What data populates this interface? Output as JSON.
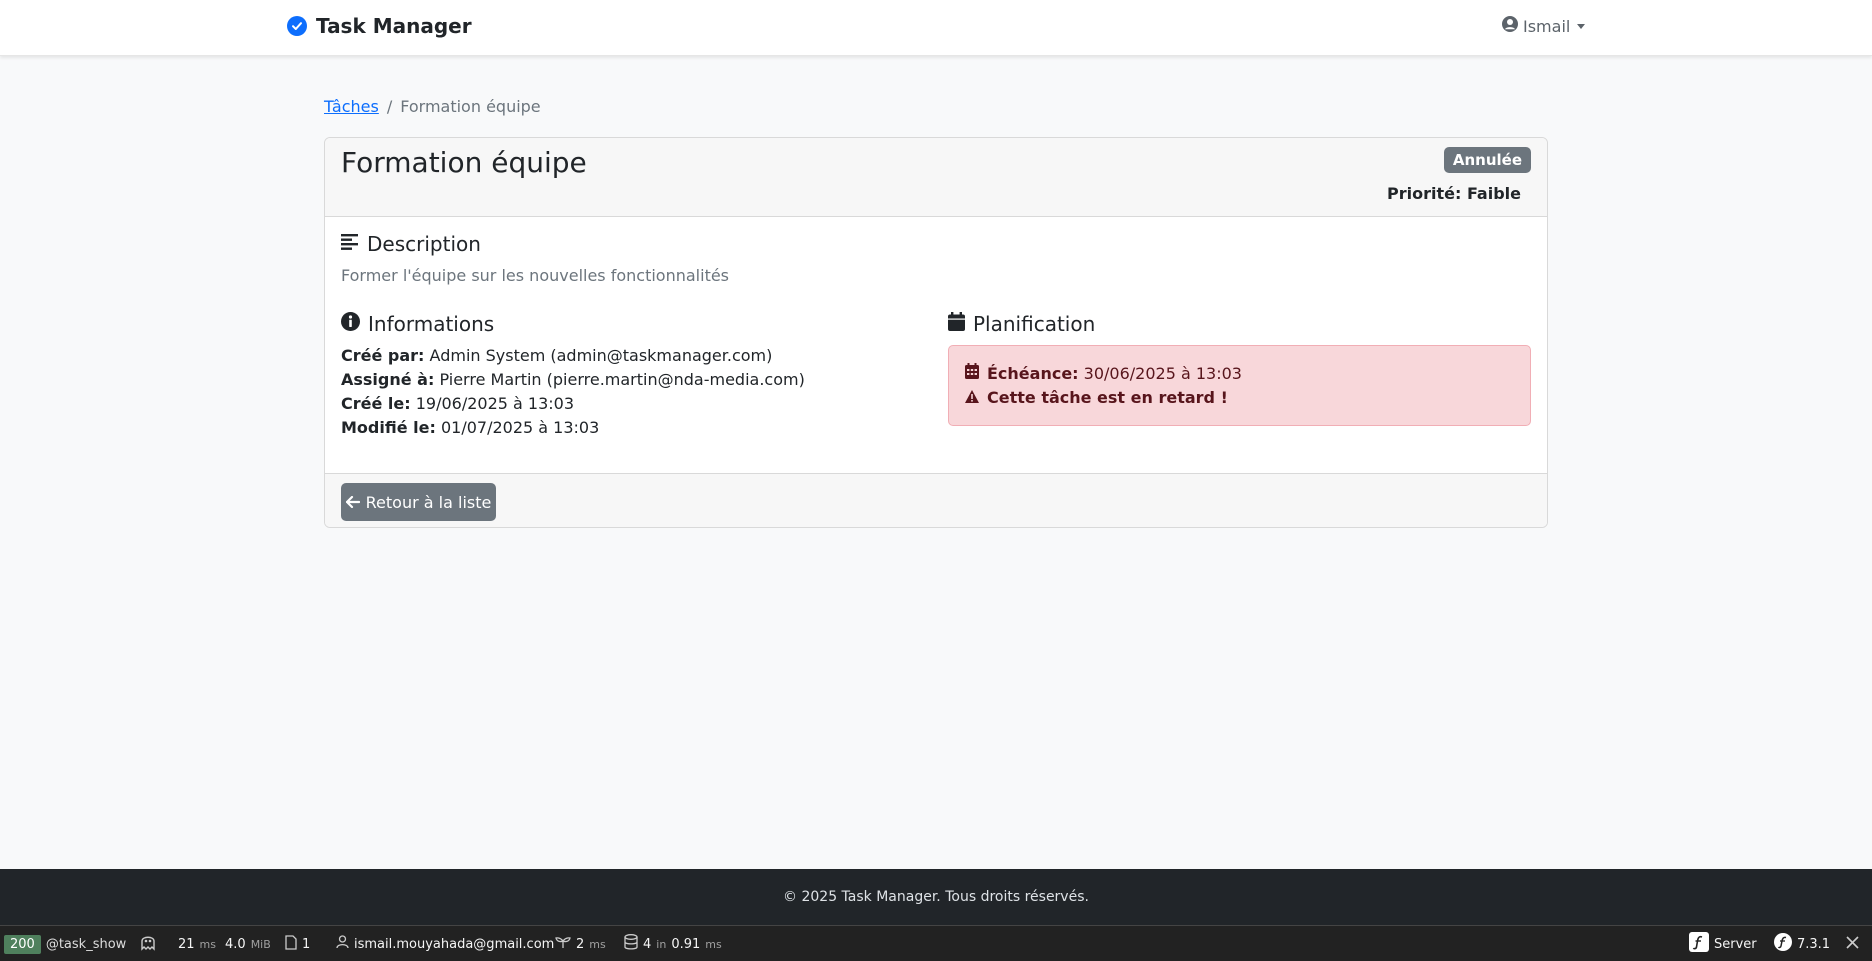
{
  "navbar": {
    "brand": "Task Manager",
    "user_name": "Ismail"
  },
  "breadcrumb": {
    "parent": "Tâches",
    "separator": "/",
    "current": "Formation équipe"
  },
  "task": {
    "title": "Formation équipe",
    "status": "Annulée",
    "priority": "Priorité: Faible"
  },
  "description": {
    "heading": "Description",
    "text": "Former l'équipe sur les nouvelles fonctionnalités"
  },
  "informations": {
    "heading": "Informations",
    "items": [
      {
        "label": "Créé par:",
        "value": "Admin System (admin@taskmanager.com)"
      },
      {
        "label": "Assigné à:",
        "value": "Pierre Martin (pierre.martin@nda-media.com)"
      },
      {
        "label": "Créé le:",
        "value": "19/06/2025 à 13:03"
      },
      {
        "label": "Modifié le:",
        "value": "01/07/2025 à 13:03"
      }
    ]
  },
  "planification": {
    "heading": "Planification",
    "due_label": "Échéance:",
    "due_value": "30/06/2025 à 13:03",
    "late_warning": "Cette tâche est en retard !"
  },
  "actions": {
    "back_label": "Retour à la liste"
  },
  "footer": {
    "copyright": "© 2025 Task Manager. Tous droits réservés."
  },
  "debug_toolbar": {
    "status_code": "200",
    "route": "@task_show",
    "time_value": "21",
    "time_unit": "ms",
    "memory_value": "4.0",
    "memory_unit": "MiB",
    "forms_count": "1",
    "user": "ismail.mouyahada@gmail.com",
    "twig_value": "2",
    "twig_unit": "ms",
    "db_queries": "4",
    "db_in": "in",
    "db_time": "0.91",
    "db_unit": "ms",
    "server_label": "Server",
    "symfony_version": "7.3.1"
  },
  "colors": {
    "primary": "#0d6efd",
    "secondary": "#6c757d",
    "danger_bg": "#f8d7da",
    "danger_text": "#58151c",
    "dark": "#212529",
    "toolbar_status": "#4f805d"
  }
}
